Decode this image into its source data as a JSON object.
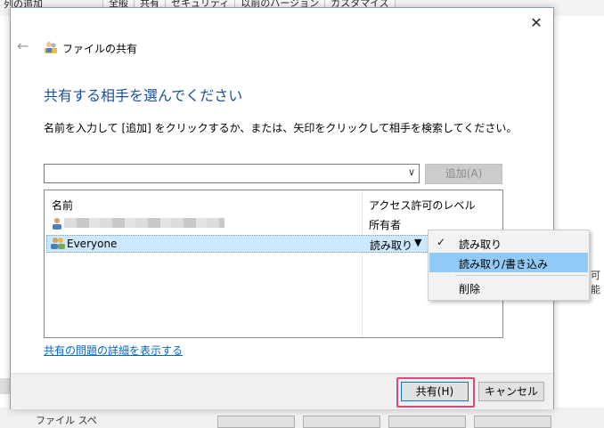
{
  "background": {
    "column_add": "列の追加",
    "tabs": [
      "全般",
      "共有",
      "セキュリティ",
      "以前のバージョン",
      "カスタマイズ"
    ],
    "right_fragment": "可能",
    "bottom_fragment": "ファイル スペ"
  },
  "dialog": {
    "title": "ファイルの共有",
    "heading": "共有する相手を選んでください",
    "instruction": "名前を入力して [追加] をクリックするか、または、矢印をクリックして相手を検索してください。",
    "name_input_value": "",
    "add_button": "追加(A)",
    "list": {
      "col_name": "名前",
      "col_level": "アクセス許可のレベル",
      "rows": [
        {
          "name": "",
          "level": "所有者"
        },
        {
          "name": "Everyone",
          "level": "読み取り"
        }
      ]
    },
    "problems_link": "共有の問題の詳細を表示する",
    "share_button": "共有(H)",
    "cancel_button": "キャンセル"
  },
  "context_menu": {
    "items": [
      {
        "label": "読み取り",
        "checked": true
      },
      {
        "label": "読み取り/書き込み",
        "highlighted": true
      },
      {
        "label": "削除"
      }
    ]
  },
  "colors": {
    "heading": "#1a4fa0",
    "link": "#0066cc",
    "selection": "#cce8ff",
    "menu_highlight": "#91c9f7",
    "focus_outline": "#e0457b"
  }
}
